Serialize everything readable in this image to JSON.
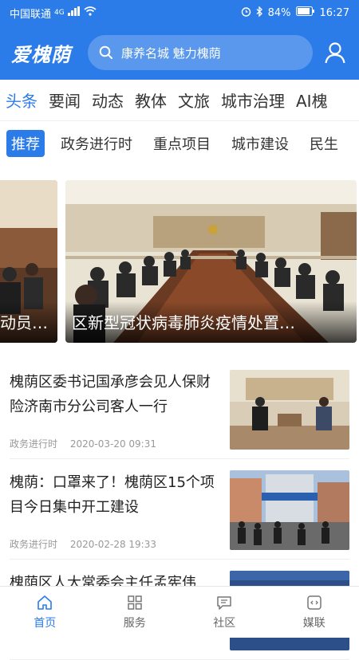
{
  "status_bar": {
    "carrier": "中国联通",
    "network": "4G",
    "battery": "84%",
    "time": "16:27"
  },
  "header": {
    "logo": "爱槐荫",
    "search_text": "康养名城 魅力槐荫",
    "accent_color": "#2b7ce8"
  },
  "channels": [
    {
      "label": "头条",
      "active": true
    },
    {
      "label": "要闻"
    },
    {
      "label": "动态"
    },
    {
      "label": "教体"
    },
    {
      "label": "文旅"
    },
    {
      "label": "城市治理"
    },
    {
      "label": "AI槐"
    }
  ],
  "sub_tabs": [
    {
      "label": "推荐",
      "active": true
    },
    {
      "label": "政务进行时"
    },
    {
      "label": "重点项目"
    },
    {
      "label": "城市建设"
    },
    {
      "label": "民生"
    }
  ],
  "carousel": {
    "prev_caption": "动员…",
    "main_caption": "区新型冠状病毒肺炎疫情处置…"
  },
  "news": [
    {
      "title": "槐荫区委书记国承彦会见人保财险济南市分公司客人一行",
      "category": "政务进行时",
      "time": "2020-03-20 09:31"
    },
    {
      "title": "槐荫：口罩来了！槐荫区15个项目今日集中开工建设",
      "category": "政务进行时",
      "time": "2020-02-28 19:33"
    },
    {
      "title": "槐荫区人大常委会主任孟宪伟",
      "category": "",
      "time": ""
    }
  ],
  "bottom_nav": [
    {
      "label": "首页",
      "icon": "home-icon",
      "active": true
    },
    {
      "label": "服务",
      "icon": "grid-icon"
    },
    {
      "label": "社区",
      "icon": "chat-icon"
    },
    {
      "label": "媒联",
      "icon": "media-icon"
    }
  ]
}
